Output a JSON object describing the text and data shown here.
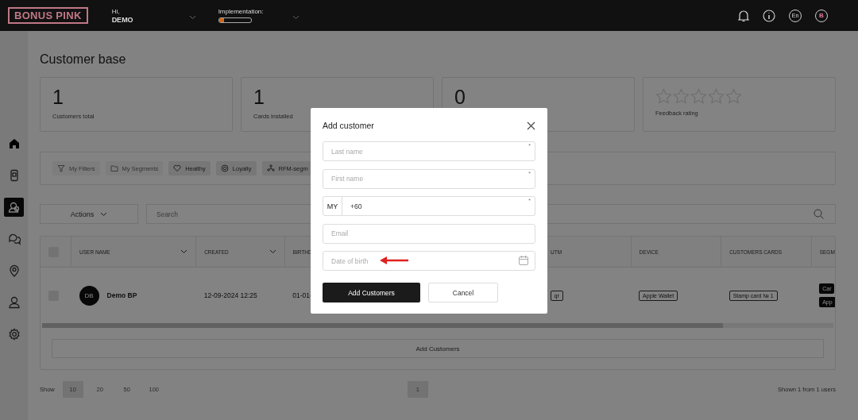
{
  "header": {
    "logo": "BONUS PINK",
    "greeting": "Hi,",
    "user": "DEMO",
    "implementation_label": "Implementation:",
    "implementation": {
      "level": 0.15
    },
    "language": "En",
    "avatar_letter": "B"
  },
  "sidebar": {
    "items": [
      {
        "kind": "home",
        "selected": false
      },
      {
        "kind": "phone",
        "selected": false
      },
      {
        "kind": "customers",
        "selected": true
      },
      {
        "kind": "chat",
        "selected": false
      },
      {
        "kind": "location",
        "selected": false
      },
      {
        "kind": "user",
        "selected": false
      },
      {
        "kind": "settings",
        "selected": false
      }
    ]
  },
  "page_title": "Customer base",
  "stats": [
    {
      "kind": "number",
      "value": "1",
      "label": "Customers total"
    },
    {
      "kind": "number",
      "value": "1",
      "label": "Cards installed"
    },
    {
      "kind": "number",
      "value": "0"
    },
    {
      "kind": "rating",
      "stars": 0,
      "label": "Feedback rating"
    }
  ],
  "filters": [
    {
      "kind": "filter",
      "label": "My Filters",
      "disabled": true
    },
    {
      "kind": "folder",
      "label": "My Segments",
      "disabled": true
    },
    {
      "kind": "heart",
      "label": "Healthy",
      "disabled": false
    },
    {
      "kind": "loyalty",
      "label": "Loyalty",
      "disabled": false
    },
    {
      "kind": "rfm",
      "label": "RFM-segm",
      "disabled": false
    }
  ],
  "actions_button": "Actions",
  "search": {
    "placeholder": "Search"
  },
  "table": {
    "all_checked": false,
    "columns": [
      {
        "kind": "checkbox"
      },
      {
        "kind": "sortable",
        "label": "USER NAME"
      },
      {
        "kind": "sortable",
        "label": "CREATED"
      },
      {
        "kind": "plain",
        "label": "BIRTHD"
      },
      {
        "kind": "plain",
        "label": "UTM"
      },
      {
        "kind": "plain",
        "label": "DEVICE"
      },
      {
        "kind": "plain",
        "label": "CUSTOMERS CARDS"
      },
      {
        "kind": "plain",
        "label": "SEGM"
      }
    ],
    "rows": [
      {
        "checked": false,
        "avatar": "DB",
        "name": "Demo BP",
        "created": "12-09-2024 12:25",
        "birthday": "01-01-",
        "utm": "qr",
        "device": "Apple Wallet",
        "card": "Stamp card № 1",
        "segments": [
          "Car",
          "App"
        ]
      }
    ]
  },
  "add_button": "Add Customers",
  "pagination": {
    "show_label": "Show",
    "sizes": [
      {
        "label": "10",
        "selected": true
      },
      {
        "label": "20",
        "selected": false
      },
      {
        "label": "50",
        "selected": false
      },
      {
        "label": "100",
        "selected": false
      }
    ],
    "pages": [
      {
        "label": "1",
        "selected": true
      }
    ],
    "summary": "Shown 1 from 1 users"
  },
  "modal": {
    "title": "Add customer",
    "fields": [
      {
        "kind": "text",
        "placeholder": "Last name",
        "required_mark": "*",
        "annotated": false
      },
      {
        "kind": "text",
        "placeholder": "First name",
        "required_mark": "*",
        "annotated": false
      },
      {
        "kind": "phone",
        "country": "MY",
        "value": "+60",
        "required_mark": "*",
        "annotated": false
      },
      {
        "kind": "text",
        "placeholder": "Email",
        "annotated": false
      },
      {
        "kind": "date",
        "placeholder": "Date of birth",
        "annotated": true
      }
    ],
    "submit": "Add Customers",
    "cancel": "Cancel"
  }
}
